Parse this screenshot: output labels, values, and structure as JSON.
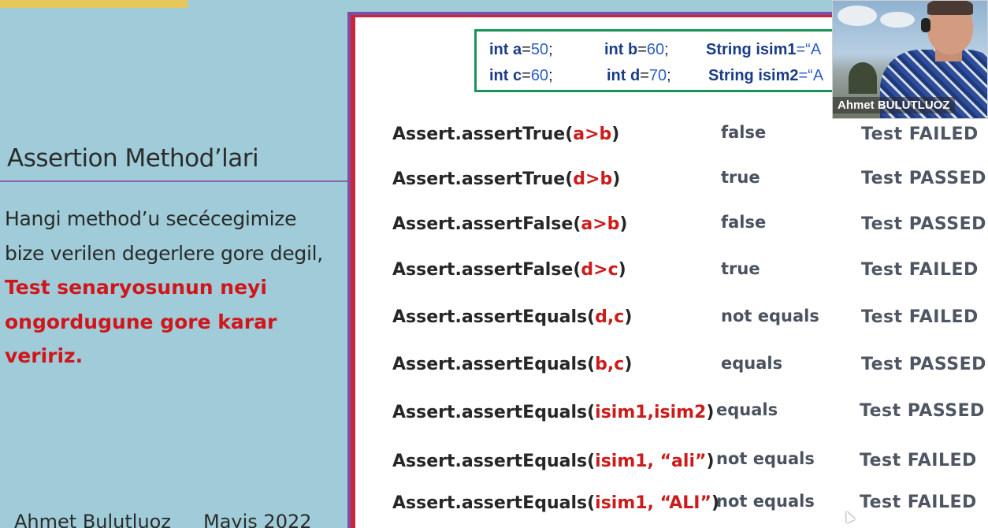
{
  "slide": {
    "title": "Assertion Method’lari",
    "body_line1": "Hangi method’u secécegimize",
    "body_line2": "bize verilen degerlere gore degil,",
    "body_strong1": "Test senaryosunun neyi",
    "body_strong2": "ongordugune gore karar",
    "body_strong3": "veririz.",
    "footer_author": "Ahmet Bulutluoz",
    "footer_date": "Mayis 2022"
  },
  "code": {
    "line1": [
      {
        "kw": "int",
        "name": "a",
        "eq": "=",
        "val": "50",
        "end": ";"
      },
      {
        "kw": "int",
        "name": "b",
        "eq": "=",
        "val": "60",
        "end": ";"
      },
      {
        "kw": "String",
        "name": "isim1",
        "eq": "=“A",
        "val": "",
        "end": ""
      }
    ],
    "line2": [
      {
        "kw": "int",
        "name": "c",
        "eq": "=",
        "val": "60",
        "end": ";"
      },
      {
        "kw": "int",
        "name": "d",
        "eq": "=",
        "val": "70",
        "end": ";"
      },
      {
        "kw": "String",
        "name": "isim2",
        "eq": "=“A",
        "val": "",
        "end": ""
      }
    ]
  },
  "rows": [
    {
      "method": "Assert.assertTrue(",
      "arg": "a>b",
      "close": ")",
      "result": "false",
      "status": "Test FAILED"
    },
    {
      "method": "Assert.assertTrue(",
      "arg": "d>b",
      "close": ")",
      "result": "true",
      "status": "Test PASSED"
    },
    {
      "method": "Assert.assertFalse(",
      "arg": "a>b",
      "close": ")",
      "result": "false",
      "status": "Test PASSED"
    },
    {
      "method": "Assert.assertFalse(",
      "arg": "d>c",
      "close": ")",
      "result": "true",
      "status": "Test FAILED"
    },
    {
      "method": "Assert.assertEquals(",
      "arg": "d,c",
      "close": ")",
      "result": "not equals",
      "status": "Test FAILED"
    },
    {
      "method": "Assert.assertEquals(",
      "arg": "b,c",
      "close": ")",
      "result": "equals",
      "status": "Test PASSED"
    },
    {
      "method": "Assert.assertEquals(",
      "arg": "isim1,isim2",
      "close": ")",
      "result": "equals",
      "status": "Test PASSED"
    },
    {
      "method": "Assert.assertEquals(",
      "arg": "isim1, “ali”",
      "close": ")",
      "result": "not equals",
      "status": "Test FAILED"
    },
    {
      "method": "Assert.assertEquals(",
      "arg": "isim1, “ALI”",
      "close": ")",
      "result": "not equals",
      "status": "Test FAILED"
    }
  ],
  "webcam": {
    "participant_name": "Ahmet BULUTLUOZ"
  },
  "colors": {
    "background": "#9fccd8",
    "accent_red": "#d0161b",
    "frame_purple": "#7d4fa2",
    "code_border": "#17945a",
    "keyword_blue": "#1a3c86"
  }
}
